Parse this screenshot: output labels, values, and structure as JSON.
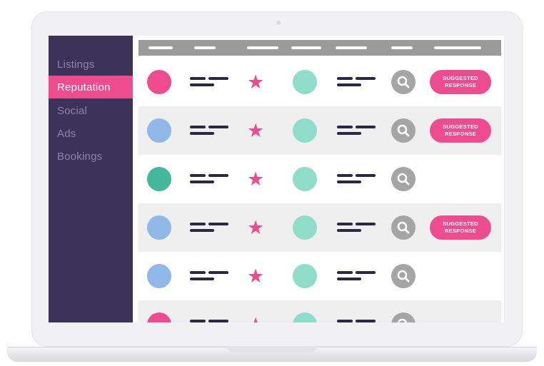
{
  "sidebar": {
    "items": [
      {
        "label": "Listings",
        "active": false
      },
      {
        "label": "Reputation",
        "active": true
      },
      {
        "label": "Social",
        "active": false
      },
      {
        "label": "Ads",
        "active": false
      },
      {
        "label": "Bookings",
        "active": false
      }
    ]
  },
  "colors": {
    "sidebar_bg": "#3b3358",
    "accent_pink": "#ee4c8f",
    "blue": "#8fb7e8",
    "mint": "#8fdcc8",
    "teal": "#45b89b",
    "navy_text_line": "#2c2745",
    "header_gray": "#9b9b9b",
    "icon_gray": "#a5a5a5"
  },
  "rows": [
    {
      "avatar_color": "#ee4c8f",
      "badge": {
        "line1": "SUGGESTED",
        "line2": "RESPONSE"
      }
    },
    {
      "avatar_color": "#8fb7e8",
      "badge": {
        "line1": "SUGGESTED",
        "line2": "RESPONSE"
      }
    },
    {
      "avatar_color": "#45b89b",
      "badge": null
    },
    {
      "avatar_color": "#8fb7e8",
      "badge": {
        "line1": "SUGGESTED",
        "line2": "RESPONSE"
      }
    },
    {
      "avatar_color": "#8fb7e8",
      "badge": null
    },
    {
      "avatar_color": "#ee4c8f",
      "badge": null
    }
  ],
  "icons": {
    "row_status": "star-icon",
    "row_action": "search-icon"
  }
}
